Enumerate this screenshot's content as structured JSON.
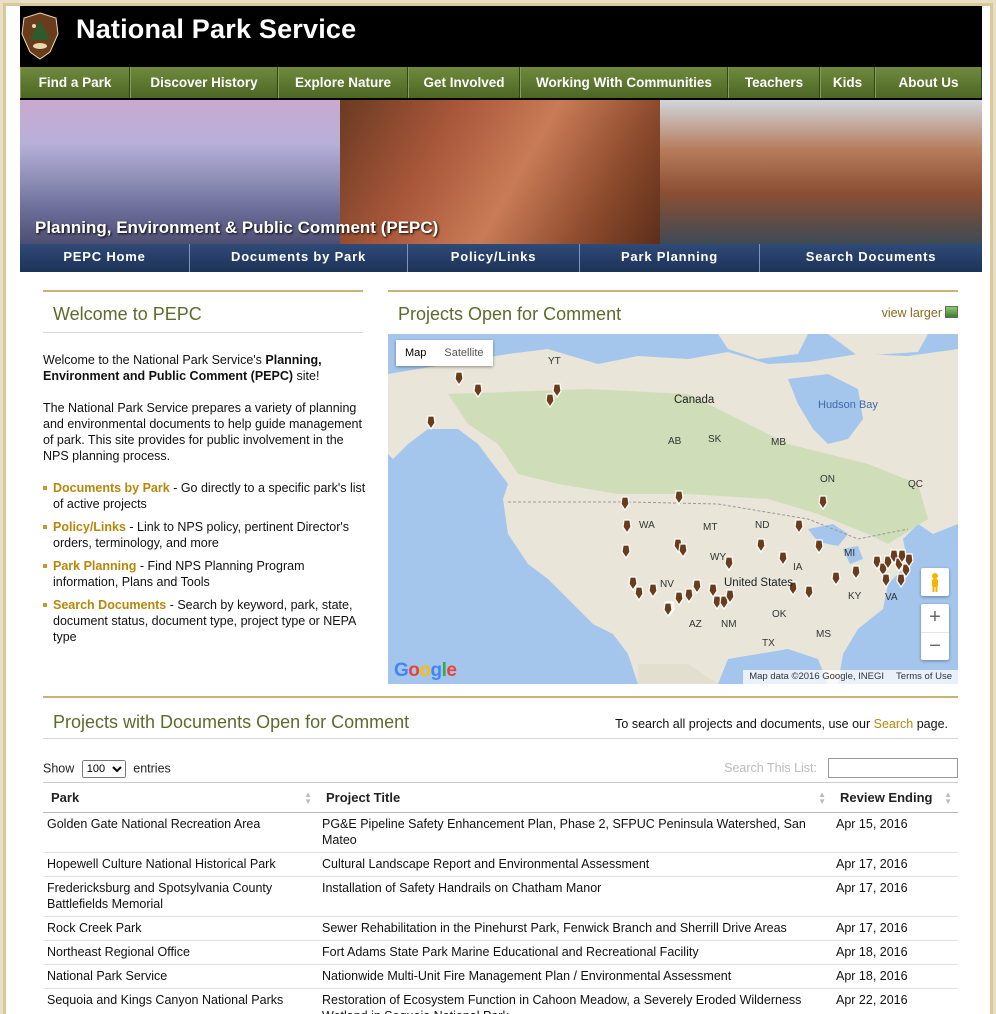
{
  "site": {
    "title": "National Park Service"
  },
  "main_nav": [
    "Find a Park",
    "Discover History",
    "Explore Nature",
    "Get Involved",
    "Working With Communities",
    "Teachers",
    "Kids",
    "About Us"
  ],
  "hero": {
    "title": "Planning, Environment & Public Comment (PEPC)"
  },
  "sub_nav": [
    "PEPC Home",
    "Documents by Park",
    "Policy/Links",
    "Park Planning",
    "Search Documents"
  ],
  "welcome": {
    "heading": "Welcome to PEPC",
    "intro_prefix": "Welcome to the National Park Service's ",
    "intro_bold": "Planning, Environment and Public Comment (PEPC)",
    "intro_suffix": " site!",
    "paragraph": "The National Park Service prepares a variety of planning and environmental documents to help guide management of park. This site provides for public involvement in the NPS planning process.",
    "links": [
      {
        "label": "Documents by Park",
        "desc": " - Go directly to a specific park's list of active projects"
      },
      {
        "label": "Policy/Links",
        "desc": " - Link to NPS policy, pertinent Director's orders, terminology, and more"
      },
      {
        "label": "Park Planning",
        "desc": " - Find NPS Planning Program information, Plans and Tools"
      },
      {
        "label": "Search Documents",
        "desc": " - Search by keyword, park, state, document status, document type, project type or NEPA type"
      }
    ]
  },
  "projects_map": {
    "heading": "Projects Open for Comment",
    "view_larger": "view larger",
    "map_types": [
      "Map",
      "Satellite"
    ],
    "labels": {
      "canada": "Canada",
      "united_states": "United States",
      "hudson_bay": "Hudson Bay",
      "yt": "YT",
      "ab": "AB",
      "sk": "SK",
      "mb": "MB",
      "on": "ON",
      "qc": "QC",
      "wa": "WA",
      "mt": "MT",
      "nd": "ND",
      "wy": "WY",
      "ia": "IA",
      "nv": "NV",
      "ok": "OK",
      "mi": "MI",
      "ky": "KY",
      "va": "VA",
      "az": "AZ",
      "nm": "NM",
      "ms": "MS",
      "tx": "TX"
    },
    "zoom_in": "+",
    "zoom_out": "−",
    "attribution": "Map data ©2016 Google, INEGI",
    "terms": "Terms of Use"
  },
  "documents": {
    "heading": "Projects with Documents Open for Comment",
    "hint_prefix": "To search all projects and documents, use our ",
    "hint_link": "Search",
    "hint_suffix": " page.",
    "show_label": "Show",
    "entries_value": "100",
    "entries_label": "entries",
    "search_label": "Search This List:",
    "columns": [
      "Park",
      "Project Title",
      "Review Ending"
    ],
    "rows": [
      {
        "park": "Golden Gate National Recreation Area",
        "title": "PG&E Pipeline Safety Enhancement Plan, Phase 2, SFPUC Peninsula Watershed, San Mateo",
        "ending": "Apr 15, 2016"
      },
      {
        "park": "Hopewell Culture National Historical Park",
        "title": "Cultural Landscape Report and Environmental Assessment",
        "ending": "Apr 17, 2016"
      },
      {
        "park": "Fredericksburg and Spotsylvania County Battlefields Memorial",
        "title": "Installation of Safety Handrails on Chatham Manor",
        "ending": "Apr 17, 2016"
      },
      {
        "park": "Rock Creek Park",
        "title": "Sewer Rehabilitation in the Pinehurst Park, Fenwick Branch and Sherrill Drive Areas",
        "ending": "Apr 17, 2016"
      },
      {
        "park": "Northeast Regional Office",
        "title": "Fort Adams State Park Marine Educational and Recreational Facility",
        "ending": "Apr 18, 2016"
      },
      {
        "park": "National Park Service",
        "title": "Nationwide Multi-Unit Fire Management Plan / Environmental Assessment",
        "ending": "Apr 18, 2016"
      },
      {
        "park": "Sequoia and Kings Canyon National Parks",
        "title": "Restoration of Ecosystem Function in Cahoon Meadow, a Severely Eroded Wilderness Wetland in Sequoia National Park",
        "ending": "Apr 22, 2016"
      }
    ]
  },
  "colors": {
    "nav_green": "#5b7530",
    "nav_blue": "#23395f",
    "accent_gold": "#b8860b",
    "heading_olive": "#5c6b2c"
  }
}
